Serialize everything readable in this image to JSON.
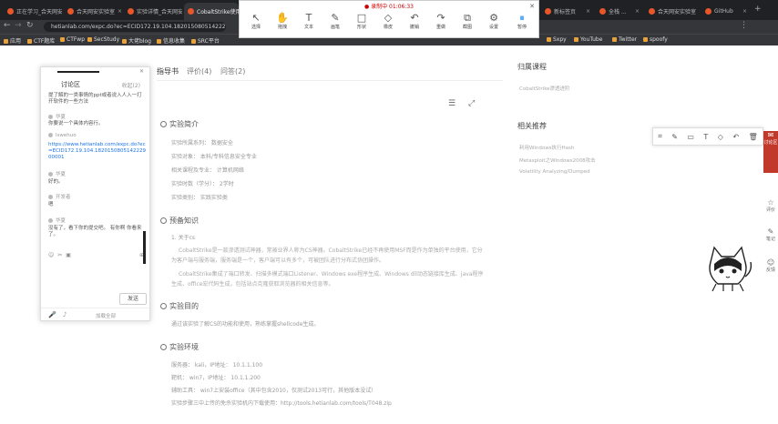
{
  "browser": {
    "tabs": [
      {
        "label": "正在学习_合天网安实验室"
      },
      {
        "label": "合天网安实验室"
      },
      {
        "label": "实验详情_合天网安"
      },
      {
        "label": "CobaltStrike使用"
      },
      {
        "label": "新标签页"
      },
      {
        "label": "全栈 ..."
      },
      {
        "label": "合天网安实验室"
      },
      {
        "label": "GitHub"
      }
    ],
    "url": "hetianlab.com/expc.do?ec=ECID172.19.104.182015080514222900001",
    "bookmarks": [
      "应用",
      "CTF题库",
      "CTFwp",
      "SecStudy",
      "大佬blog",
      "信息收集",
      "SRC平台",
      "Sxpy",
      "YouTube",
      "Twitter",
      "spoofy"
    ]
  },
  "recorder": {
    "status": "● 录制中 01:06:33",
    "tools": [
      {
        "label": "选择",
        "icon": "cursor-icon"
      },
      {
        "label": "拖拽",
        "icon": "hand-icon"
      },
      {
        "label": "文本",
        "icon": "text-icon"
      },
      {
        "label": "画笔",
        "icon": "pen-icon"
      },
      {
        "label": "形状",
        "icon": "shape-icon"
      },
      {
        "label": "橡皮",
        "icon": "eraser-icon"
      },
      {
        "label": "撤销",
        "icon": "undo-icon"
      },
      {
        "label": "重做",
        "icon": "redo-icon"
      },
      {
        "label": "截图",
        "icon": "screenshot-icon"
      },
      {
        "label": "设置",
        "icon": "gear-icon"
      },
      {
        "label": "暂停",
        "icon": "pause-icon"
      }
    ]
  },
  "page_tabs": [
    "指导书",
    "评价(4)",
    "问答(2)"
  ],
  "sections": {
    "intro_title": "实验简介",
    "intro_lines": [
      "实验所属系列：  数据安全",
      "实验对象：  本科/专科信息安全专业",
      "相关课程及专业：  计算机网络",
      "实验时数（学分）：  2学时",
      "实验类别：  实践实验类"
    ],
    "pre_title": "预备知识",
    "pre_sub": "1. 关于cs",
    "pre_p1": "CobaltStrike是一款渗透测试神器，常被业界人称为CS神器。CobaltStrike已经不再使用MSF而是作为单独的平台使用，它分为客户端与服务端，服务端是一个，客户端可以有多个，可被团队进行分布式协团操作。",
    "pre_p2": "CobaltStrike集成了端口转发、扫描多模式端口Listener、Windows exe程序生成、Windows dll动态链接库生成、java程序生成、office宏代码生成，包括站点克隆获取浏览器的相关信息等。",
    "goal_title": "实验目的",
    "goal_line": "通过该实验了解CS的功能和使用，熟练掌握shellcode生成。",
    "env_title": "实验环境",
    "env_lines": [
      "服务器：  kali，IP地址：  10.1.1.100",
      "靶机：  win7，IP地址：  10.1.1.200",
      "辅助工具：  win7上安装office（其中包含2010，仅测试2013可行，其他版本没试）",
      "实验步骤三中上传的免杀实验机内下载使用：http://tools.hetianlab.com/tools/T048.zip"
    ]
  },
  "rightcol": {
    "course_title": "归属课程",
    "course_item": "CobaltStrike渗透进阶",
    "rec_title": "相关推荐",
    "rec_items": [
      "利用Windows执行Hash",
      "Metasploit之Windows2008攻击",
      "Volatility  Analyzing/Dumped"
    ]
  },
  "discussion": {
    "title": "讨论区",
    "collapse": "收起(2)",
    "close": "✕",
    "question": "提了解的一类事情的ppt或者说入人入一打开软件的一些方法",
    "messages": [
      {
        "user": "华夏",
        "text": "你要说一个具体内容行。"
      },
      {
        "user": "lswehuo",
        "text": "https://www.hetianlab.com/expc.do?ec=ECID172.19.104.182015080514222900001"
      },
      {
        "user": "华夏",
        "text": "好的。"
      },
      {
        "user": "开发者",
        "text": "嗯"
      },
      {
        "user": "华夏",
        "text": "没有了，看下你的提交吧。 有你啊 你看来了。"
      }
    ],
    "send": "发送",
    "footer": "加载全部"
  },
  "floatbar": {
    "items": [
      {
        "label": "讨论区"
      },
      {
        "label": "评价"
      },
      {
        "label": "笔记"
      },
      {
        "label": "反馈"
      }
    ]
  }
}
